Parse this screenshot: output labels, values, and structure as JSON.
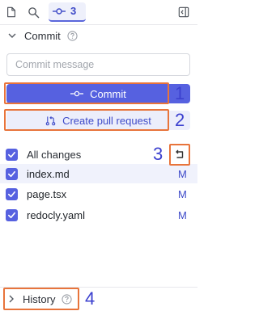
{
  "tabs": {
    "files_icon": "file-icon",
    "search_icon": "search-icon",
    "commit_icon": "commit-icon",
    "commit_count": "3",
    "panel_icon": "panel-collapse-icon"
  },
  "commit_section": {
    "title": "Commit",
    "message_placeholder": "Commit message",
    "message_value": "",
    "commit_button_label": "Commit",
    "pull_request_label": "Create pull request"
  },
  "changes": {
    "all_label": "All changes",
    "all_checked": true,
    "files": [
      {
        "name": "index.md",
        "status": "M",
        "checked": true,
        "selected": true
      },
      {
        "name": "page.tsx",
        "status": "M",
        "checked": true,
        "selected": false
      },
      {
        "name": "redocly.yaml",
        "status": "M",
        "checked": true,
        "selected": false
      }
    ]
  },
  "history_section": {
    "title": "History"
  },
  "annotations": [
    "1",
    "2",
    "3",
    "4"
  ],
  "colors": {
    "accent": "#5661e0",
    "annotation_box": "#e8743b",
    "annotation_number": "#3c41cf"
  }
}
